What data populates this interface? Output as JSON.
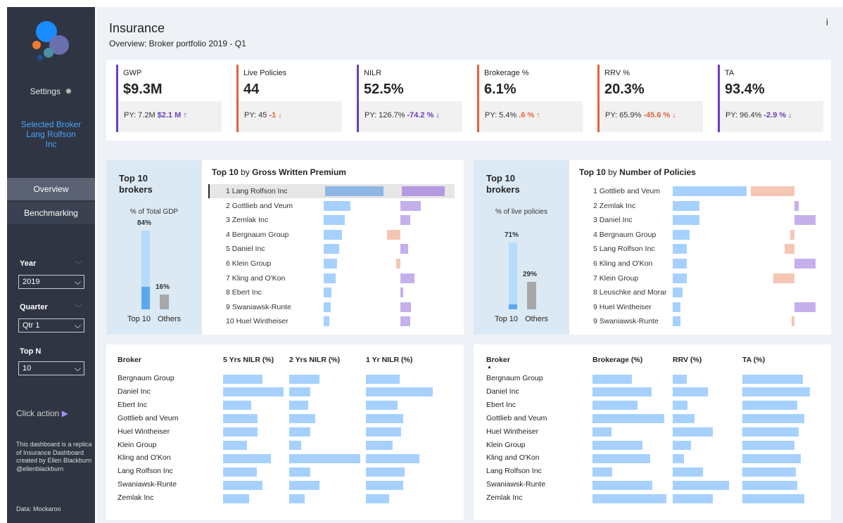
{
  "app": {
    "title": "Insurance",
    "subtitle": "Overview: Broker portfolio 2019 - Q1",
    "info": "i"
  },
  "sidebar": {
    "settings_label": "Settings",
    "selected_broker_label": "Selected Broker",
    "selected_broker_name": "Lang Rolfson Inc",
    "nav": [
      {
        "label": "Overview",
        "active": true
      },
      {
        "label": "Benchmarking",
        "active": false
      }
    ],
    "filters": {
      "year": {
        "label": "Year",
        "value": "2019"
      },
      "quarter": {
        "label": "Quarter",
        "value": "Qtr 1"
      },
      "topn": {
        "label": "Top N",
        "value": "10"
      }
    },
    "click_action": "Click action",
    "note": "This dashboard is a replica of Insurance Dashboard created by Ellen Blackburn @ellenblackburn",
    "data_note": "Data: Mockaroo"
  },
  "colors": {
    "accent_purple": "#6a3fbf",
    "accent_orange": "#e4633f",
    "sidebar_bg": "#2f3542",
    "link_blue": "#4aa3ff",
    "bar_blue": "#a6d1ff"
  },
  "kpis": [
    {
      "title": "GWP",
      "value": "$9.3M",
      "py": "PY: 7.2M",
      "delta": "$2.1 M",
      "arrow": "↑",
      "tone": "up-p",
      "border": "#6a3fbf"
    },
    {
      "title": "Live Policies",
      "value": "44",
      "py": "PY: 45",
      "delta": "-1",
      "arrow": "↓",
      "tone": "down-o",
      "border": "#e4633f"
    },
    {
      "title": "NILR",
      "value": "52.5%",
      "py": "PY: 126.7%",
      "delta": "-74.2 %",
      "arrow": "↓",
      "tone": "up-p",
      "border": "#6a3fbf"
    },
    {
      "title": "Brokerage %",
      "value": "6.1%",
      "py": "PY: 5.4%",
      "delta": ".6 %",
      "arrow": "↑",
      "tone": "down-o",
      "border": "#e4633f"
    },
    {
      "title": "RRV %",
      "value": "20.3%",
      "py": "PY: 65.9%",
      "delta": "-45.6 %",
      "arrow": "↓",
      "tone": "down-o",
      "border": "#e4633f"
    },
    {
      "title": "TA",
      "value": "93.4%",
      "py": "PY: 96.4%",
      "delta": "-2.9 %",
      "arrow": "↓",
      "tone": "up-p",
      "border": "#6a3fbf"
    }
  ],
  "gwp_panel": {
    "side_title": "Top 10 brokers",
    "side_sub": "% of Total GDP",
    "top_pct": "84%",
    "others_pct": "16%",
    "top_share": 0.84,
    "others_share": 0.16,
    "x_top": "Top 10",
    "x_others": "Others",
    "list_title_prefix": "Top 10",
    "list_title_by": "by",
    "list_title_metric": "Gross Written Premium",
    "rows": [
      {
        "name": "1  Lang Rolfson Inc",
        "a": 1.0,
        "b": 1.0,
        "side": "p",
        "selected": true
      },
      {
        "name": "2  Gottlieb and Veum",
        "a": 0.46,
        "b": 0.48,
        "side": "p"
      },
      {
        "name": "3  Zemlak Inc",
        "a": 0.36,
        "b": 0.23,
        "side": "p"
      },
      {
        "name": "4  Bergnaum Group",
        "a": 0.31,
        "b": 0.31,
        "side": "s"
      },
      {
        "name": "5  Daniel Inc",
        "a": 0.26,
        "b": 0.18,
        "side": "p"
      },
      {
        "name": "6  Klein Group",
        "a": 0.23,
        "b": 0.1,
        "side": "s"
      },
      {
        "name": "7  Kling and O'Kon",
        "a": 0.2,
        "b": 0.33,
        "side": "p"
      },
      {
        "name": "8  Ebert Inc",
        "a": 0.13,
        "b": 0.07,
        "side": "p"
      },
      {
        "name": "9  Swaniawsk-Runte",
        "a": 0.12,
        "b": 0.25,
        "side": "p"
      },
      {
        "name": "10  Huel Wintheiser",
        "a": 0.1,
        "b": 0.23,
        "side": "p"
      }
    ]
  },
  "policies_panel": {
    "side_title": "Top 10 brokers",
    "side_sub": "% of live policies",
    "top_pct": "71%",
    "others_pct": "29%",
    "top_share": 0.71,
    "others_share": 0.29,
    "x_top": "Top 10",
    "x_others": "Others",
    "list_title_prefix": "Top 10",
    "list_title_by": "by",
    "list_title_metric": "Number of Policies",
    "rows": [
      {
        "name": "1  Gottlieb and Veum",
        "a": 1.0,
        "b": 1.0,
        "side": "s"
      },
      {
        "name": "2  Zemlak Inc",
        "a": 0.36,
        "b": 0.1,
        "side": "p"
      },
      {
        "name": "3  Daniel Inc",
        "a": 0.36,
        "b": 0.48,
        "side": "p"
      },
      {
        "name": "4  Bergnaum Group",
        "a": 0.23,
        "b": 0.1,
        "side": "s"
      },
      {
        "name": "5  Lang Rolfson Inc",
        "a": 0.19,
        "b": 0.23,
        "side": "s"
      },
      {
        "name": "6  Kling and O'Kon",
        "a": 0.19,
        "b": 0.48,
        "side": "p"
      },
      {
        "name": "7  Klein Group",
        "a": 0.19,
        "b": 0.48,
        "side": "s"
      },
      {
        "name": "8  Leuschke and Morar",
        "a": 0.13,
        "b": 0.0,
        "side": "p"
      },
      {
        "name": "9  Huel Wintheiser",
        "a": 0.1,
        "b": 0.48,
        "side": "p"
      },
      {
        "name": "9  Swaniawsk-Runte",
        "a": 0.1,
        "b": 0.07,
        "side": "s"
      }
    ]
  },
  "nilr_table": {
    "headers": [
      "Broker",
      "5 Yrs NILR (%)",
      "2 Yrs NILR (%)",
      "1 Yr NILR (%)"
    ],
    "rows": [
      {
        "name": "Bergnaum Group",
        "v": [
          0.65,
          0.6,
          0.5
        ]
      },
      {
        "name": "Daniel Inc",
        "v": [
          1.0,
          0.42,
          1.0
        ]
      },
      {
        "name": "Ebert Inc",
        "v": [
          0.47,
          0.38,
          0.47
        ]
      },
      {
        "name": "Gottlieb and Veum",
        "v": [
          0.57,
          0.52,
          0.56
        ]
      },
      {
        "name": "Huel Wintheiser",
        "v": [
          0.57,
          0.42,
          0.53
        ]
      },
      {
        "name": "Klein Group",
        "v": [
          0.4,
          0.23,
          0.4
        ]
      },
      {
        "name": "Kling and O'Kon",
        "v": [
          0.79,
          1.4,
          0.8
        ]
      },
      {
        "name": "Lang Rolfson Inc",
        "v": [
          0.56,
          0.42,
          0.58
        ]
      },
      {
        "name": "Swaniawsk-Runte",
        "v": [
          0.65,
          0.6,
          0.56
        ]
      },
      {
        "name": "Zemlak Inc",
        "v": [
          0.43,
          0.3,
          0.35
        ]
      }
    ]
  },
  "brokerage_table": {
    "headers": [
      "Broker",
      "Brokerage (%)",
      "RRV (%)",
      "TA (%)"
    ],
    "sort_indicator": "▲",
    "rows": [
      {
        "name": "Bergnaum Group",
        "v": [
          0.55,
          0.4,
          0.88
        ]
      },
      {
        "name": "Daniel Inc",
        "v": [
          0.82,
          1.0,
          0.98
        ]
      },
      {
        "name": "Ebert Inc",
        "v": [
          0.63,
          0.42,
          0.8
        ]
      },
      {
        "name": "Gottlieb and Veum",
        "v": [
          1.0,
          0.62,
          0.9
        ]
      },
      {
        "name": "Huel Wintheiser",
        "v": [
          0.26,
          1.15,
          0.82
        ]
      },
      {
        "name": "Klein Group",
        "v": [
          0.7,
          0.52,
          0.75
        ]
      },
      {
        "name": "Kling and O'Kon",
        "v": [
          0.8,
          0.32,
          0.85
        ]
      },
      {
        "name": "Lang Rolfson Inc",
        "v": [
          0.27,
          0.85,
          0.78
        ]
      },
      {
        "name": "Swaniawsk-Runte",
        "v": [
          0.83,
          1.6,
          0.8
        ]
      },
      {
        "name": "Zemlak Inc",
        "v": [
          1.03,
          1.15,
          0.9
        ]
      }
    ]
  }
}
